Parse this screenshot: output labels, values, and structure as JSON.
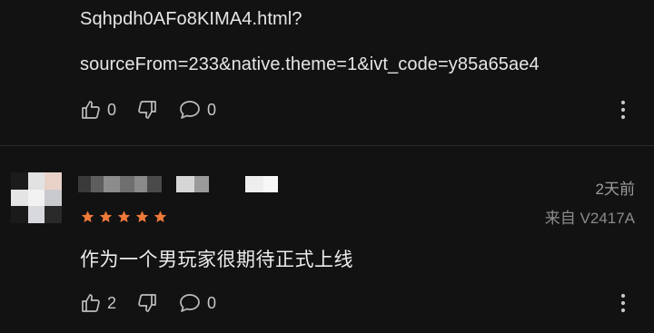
{
  "prev_comment": {
    "text_line1": "Sqhpdh0AFo8KIMA4.html?",
    "text_line2": "sourceFrom=233&native.theme=1&ivt_code=y85a65ae4",
    "likes": "0",
    "replies": "0"
  },
  "comment": {
    "time": "2天前",
    "device": "来自 V2417A",
    "rating_stars": 5,
    "star_color": "#f07a3a",
    "text": "作为一个男玩家很期待正式上线",
    "likes": "2",
    "replies": "0"
  },
  "icons": [
    "thumbs-up-icon",
    "thumbs-down-icon",
    "comment-bubble-icon",
    "more-vertical-icon",
    "star-icon"
  ]
}
